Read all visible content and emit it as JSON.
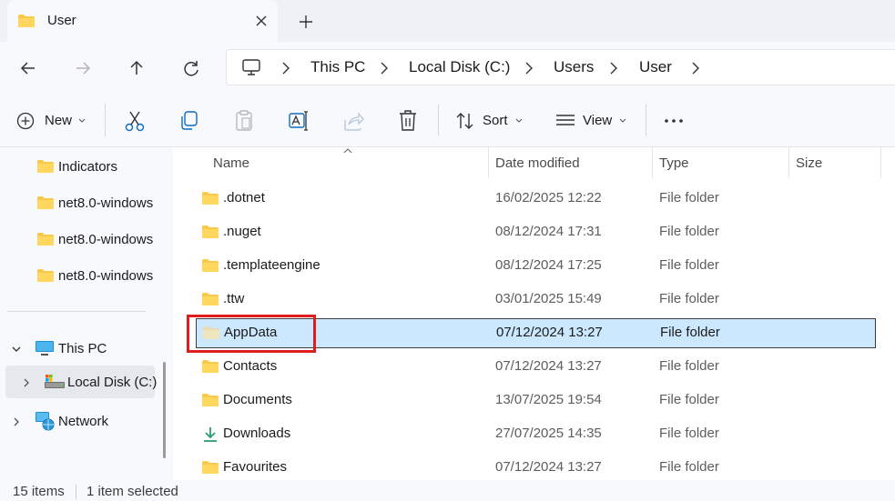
{
  "window": {
    "tab_title": "User",
    "icons": {
      "tab": "folder-icon",
      "close": "close-icon",
      "new_tab": "plus-icon"
    }
  },
  "nav": {
    "icons": [
      "back-arrow-icon",
      "forward-arrow-icon",
      "up-arrow-icon",
      "refresh-icon"
    ],
    "breadcrumb": [
      "This PC",
      "Local Disk (C:)",
      "Users",
      "User"
    ]
  },
  "toolbar": {
    "new_label": "New",
    "sort_label": "Sort",
    "view_label": "View",
    "icons": [
      "plus-circle-icon",
      "scissors-icon",
      "copy-icon",
      "paste-icon",
      "rename-icon",
      "share-icon",
      "trash-icon",
      "sort-icon",
      "view-lines-icon",
      "more-icon"
    ]
  },
  "sidebar": {
    "items": [
      {
        "label": "Indicators",
        "icon": "folder-icon"
      },
      {
        "label": "net8.0-windows",
        "icon": "folder-icon"
      },
      {
        "label": "net8.0-windows",
        "icon": "folder-icon"
      },
      {
        "label": "net8.0-windows",
        "icon": "folder-icon"
      },
      {
        "label": "This PC",
        "icon": "monitor-icon",
        "expanded": true
      },
      {
        "label": "Local Disk (C:)",
        "icon": "drive-icon",
        "selected": true
      },
      {
        "label": "Network",
        "icon": "network-icon"
      }
    ]
  },
  "columns": {
    "name": "Name",
    "date": "Date modified",
    "type": "Type",
    "size": "Size"
  },
  "files": [
    {
      "name": ".dotnet",
      "date": "16/02/2025 12:22",
      "type": "File folder",
      "icon": "folder-icon"
    },
    {
      "name": ".nuget",
      "date": "08/12/2024 17:31",
      "type": "File folder",
      "icon": "folder-icon"
    },
    {
      "name": ".templateengine",
      "date": "08/12/2024 17:25",
      "type": "File folder",
      "icon": "folder-icon"
    },
    {
      "name": ".ttw",
      "date": "03/01/2025 15:49",
      "type": "File folder",
      "icon": "folder-icon"
    },
    {
      "name": "AppData",
      "date": "07/12/2024 13:27",
      "type": "File folder",
      "icon": "hidden-folder-icon",
      "selected": true
    },
    {
      "name": "Contacts",
      "date": "07/12/2024 13:27",
      "type": "File folder",
      "icon": "folder-icon"
    },
    {
      "name": "Documents",
      "date": "13/07/2025 19:54",
      "type": "File folder",
      "icon": "folder-icon"
    },
    {
      "name": "Downloads",
      "date": "27/07/2025 14:35",
      "type": "File folder",
      "icon": "download-icon"
    },
    {
      "name": "Favourites",
      "date": "07/12/2024 13:27",
      "type": "File folder",
      "icon": "folder-icon"
    }
  ],
  "status": {
    "count": "15 items",
    "selected": "1 item selected"
  },
  "colors": {
    "selection": "#cce8ff",
    "highlight": "#e01c1c",
    "folder": "#f8c94a",
    "accent": "#0067c0"
  }
}
